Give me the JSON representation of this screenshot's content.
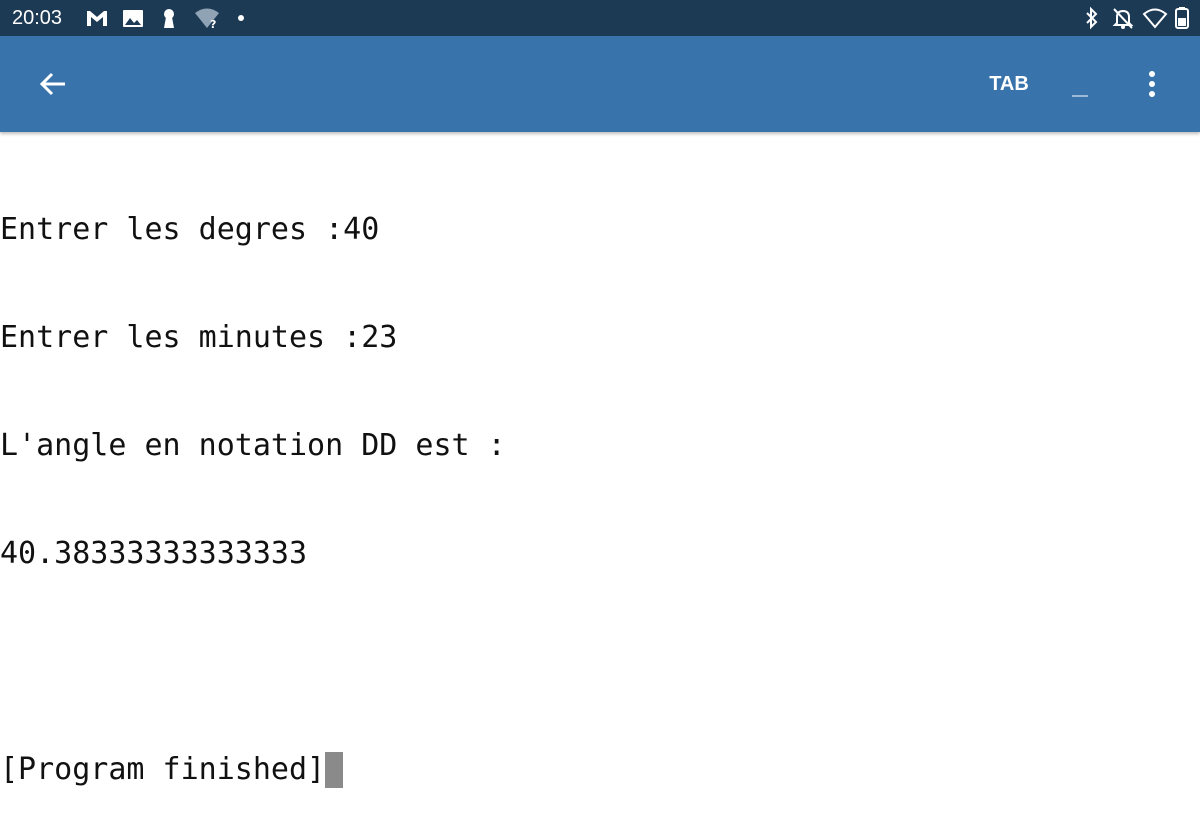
{
  "status_bar": {
    "time": "20:03",
    "icons_left": [
      "gmail-icon",
      "image-icon",
      "keyhole-icon",
      "wifi-question-icon",
      "dot-icon"
    ],
    "icons_right": [
      "bluetooth-icon",
      "notifications-off-icon",
      "wifi-icon",
      "battery-icon"
    ],
    "background": "#1d3a55"
  },
  "app_bar": {
    "background": "#3874ab",
    "back_icon": "arrow-left-icon",
    "tab_label": "TAB",
    "underscore_label": "_",
    "menu_icon": "more-vert-icon"
  },
  "terminal": {
    "lines": [
      "Entrer les degres :40",
      "Entrer les minutes :23",
      "L'angle en notation DD est :",
      "40.38333333333333",
      "",
      "[Program finished]"
    ],
    "cursor_color": "#8a8a8a"
  }
}
